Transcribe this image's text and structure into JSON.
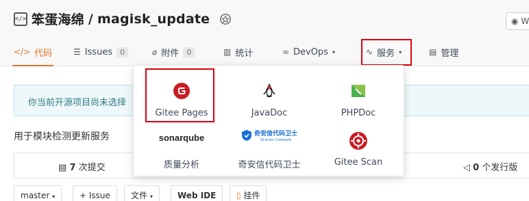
{
  "repo": {
    "owner": "笨蛋海绵",
    "separator": "/",
    "name": "magisk_update",
    "icon_text": "</>",
    "watch_label": "W"
  },
  "tabs": [
    {
      "label": "代码",
      "icon": "code-icon",
      "glyph": "</>",
      "active": true
    },
    {
      "label": "Issues",
      "icon": "issues-icon",
      "glyph": "☰",
      "count": "0"
    },
    {
      "label": "附件",
      "icon": "paperclip-icon",
      "glyph": "⌀",
      "count": "0"
    },
    {
      "label": "统计",
      "icon": "bar-chart-icon",
      "glyph": "▥"
    },
    {
      "label": "DevOps",
      "icon": "infinity-icon",
      "glyph": "∞",
      "caret": "▾"
    },
    {
      "label": "服务",
      "icon": "pulse-icon",
      "glyph": "∿",
      "caret": "▾"
    },
    {
      "label": "管理",
      "icon": "settings-doc-icon",
      "glyph": "▤"
    }
  ],
  "notice": {
    "text": "你当前开源项目尚未选择"
  },
  "description": "用于模块检测更新服务",
  "stats": {
    "commits_count": "7",
    "commits_label": "次提交",
    "releases_count": "0",
    "releases_label": "个发行版"
  },
  "buttons": {
    "branch": "master",
    "branch_caret": "▾",
    "issue": "+ Issue",
    "file": "文件",
    "file_caret": "▾",
    "webide": "Web IDE",
    "widget": "挂件"
  },
  "services": [
    {
      "label": "Gitee Pages",
      "icon": "gitee-pages-icon"
    },
    {
      "label": "JavaDoc",
      "icon": "javadoc-icon"
    },
    {
      "label": "PHPDoc",
      "icon": "phpdoc-icon"
    },
    {
      "label": "质量分析",
      "icon": "sonarqube-icon",
      "logo_text": "sonarqube"
    },
    {
      "label": "奇安信代码卫士",
      "icon": "qianxin-icon",
      "logo_text": "奇安信代码卫士",
      "logo_sub": "Qi'anxin Codesafe"
    },
    {
      "label": "Gitee Scan",
      "icon": "gitee-scan-icon"
    }
  ],
  "colors": {
    "accent": "#e3742a",
    "highlight_box": "#d9000f",
    "gitee_red": "#c71d23",
    "phpdoc_green": "#4caf50",
    "qianxin_blue": "#1a6fd6",
    "notice_bg": "#eef8fa"
  }
}
